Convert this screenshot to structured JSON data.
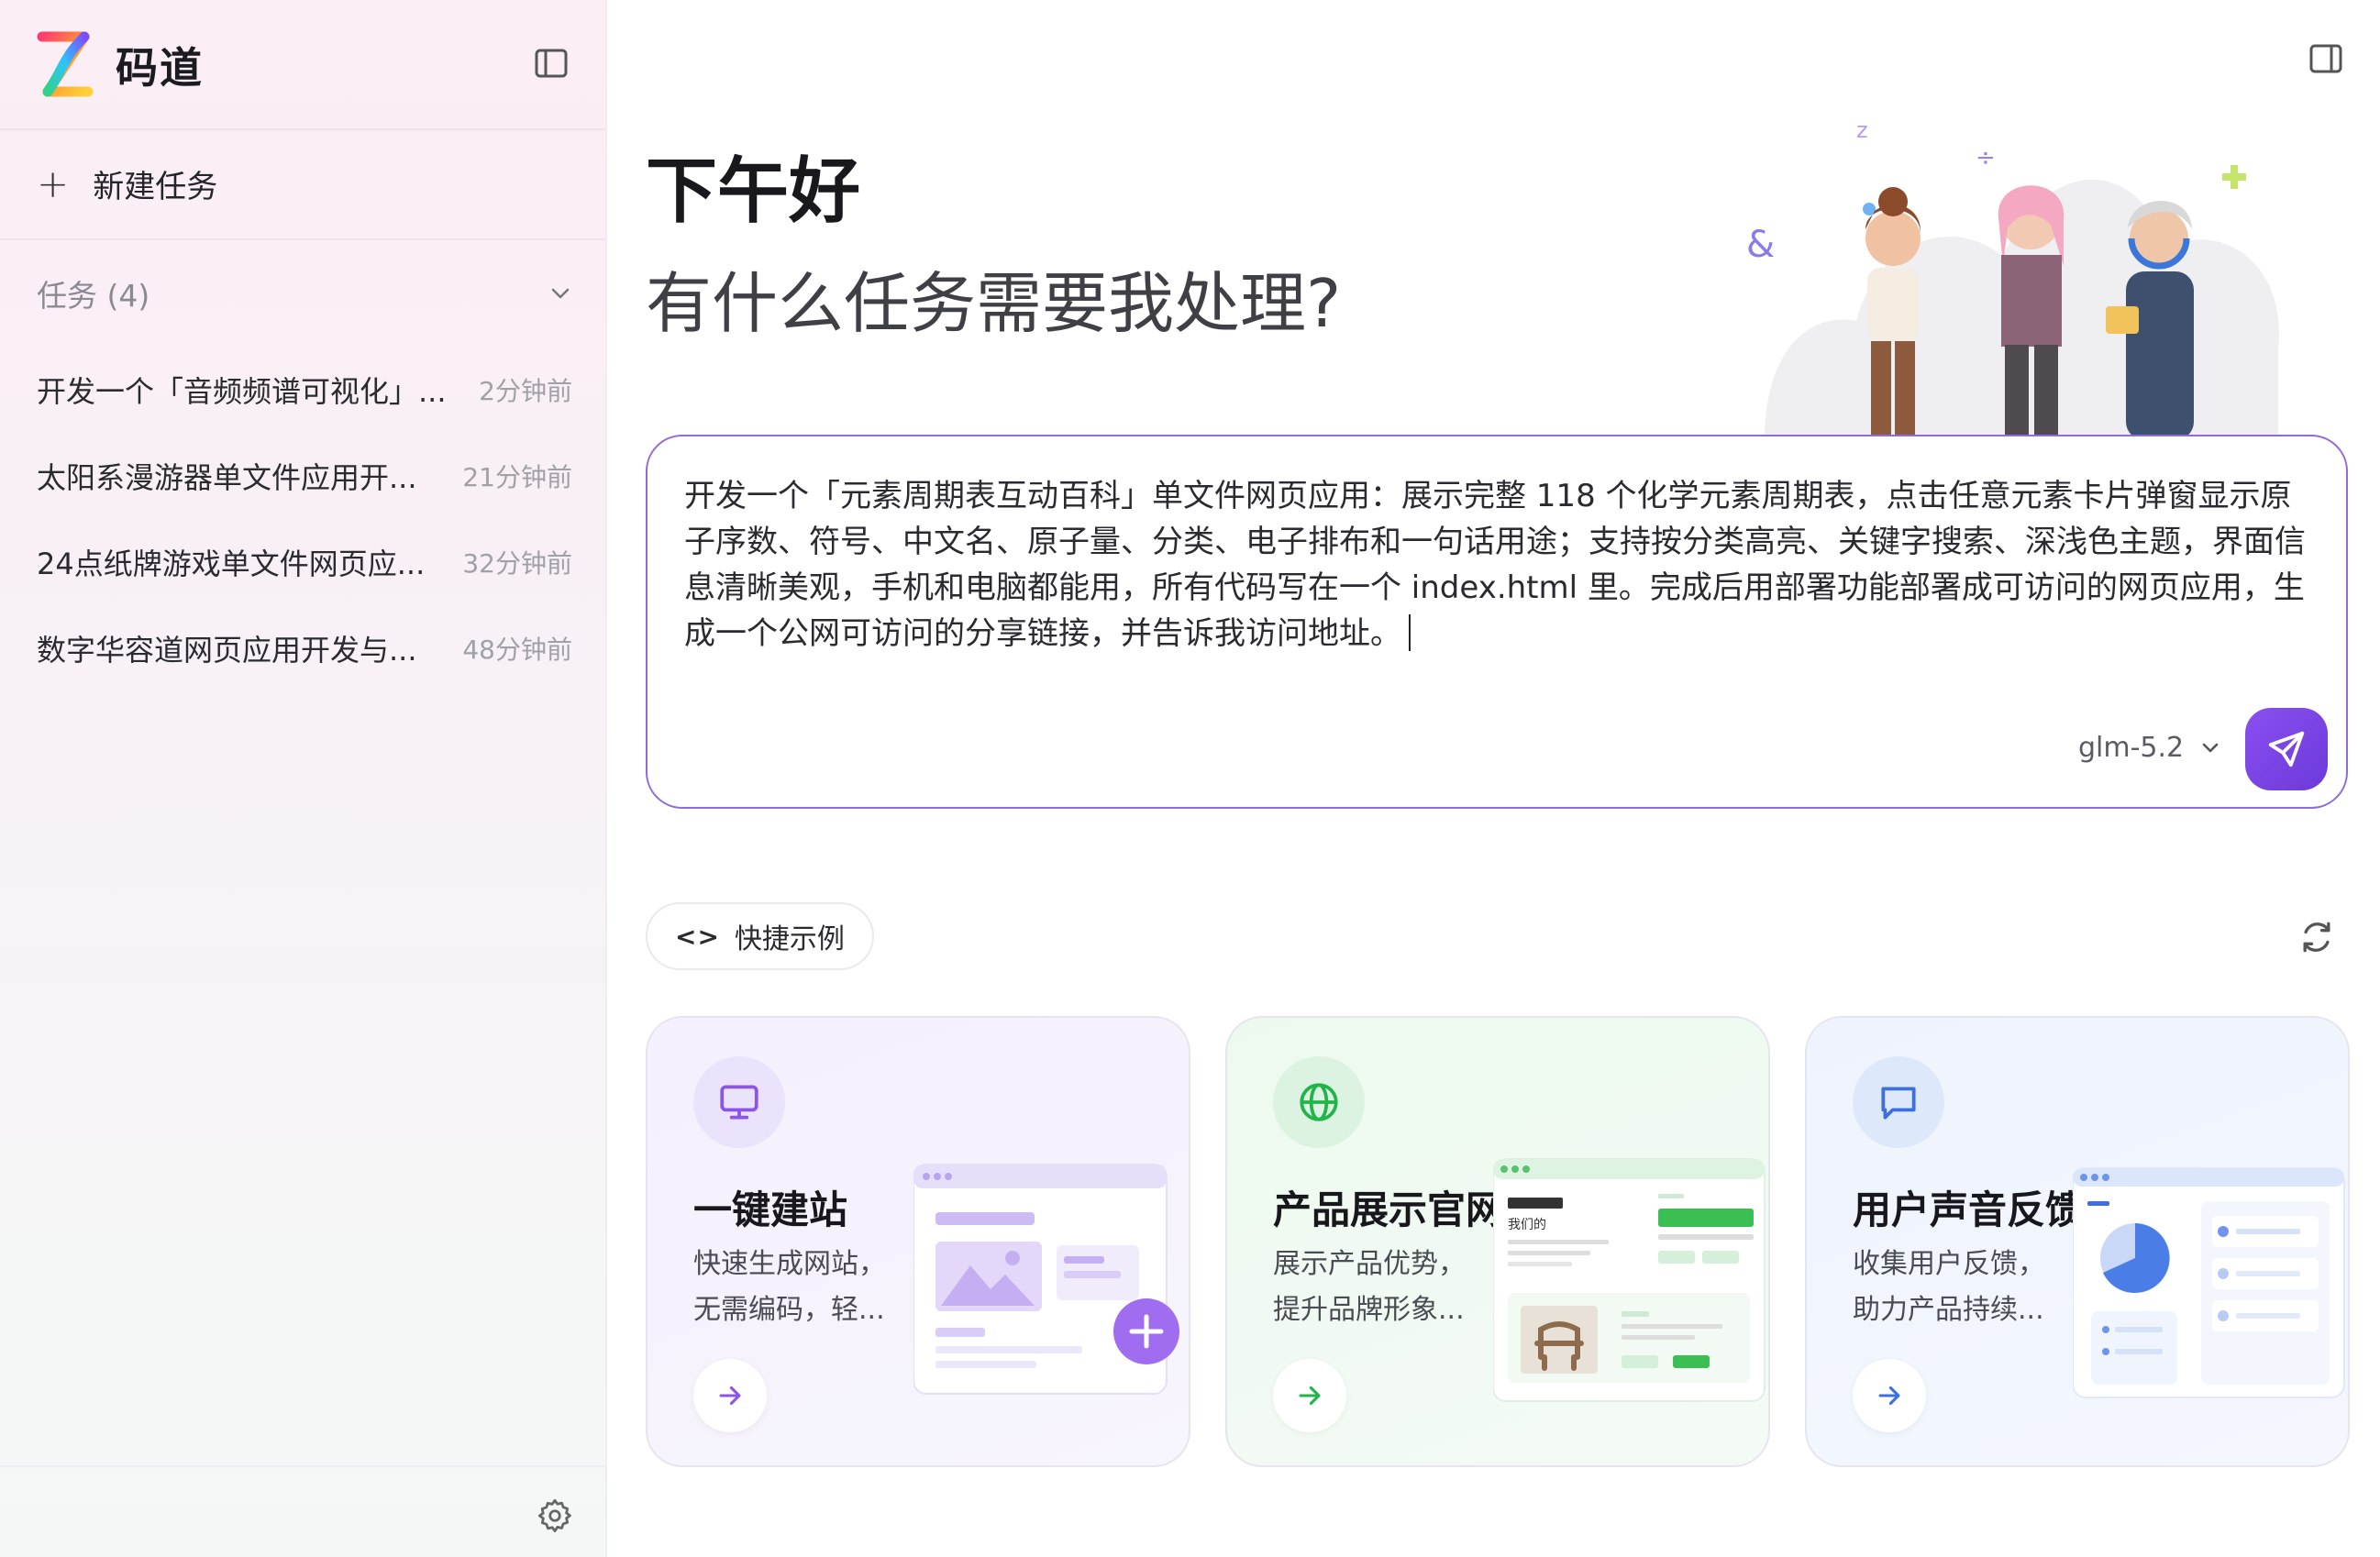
{
  "brand": {
    "name": "码道"
  },
  "sidebar": {
    "new_task_label": "新建任务",
    "tasks_header": "任务 (4)",
    "tasks": [
      {
        "title": "开发一个「音频频谱可视化」...",
        "time": "2分钟前"
      },
      {
        "title": "太阳系漫游器单文件应用开...",
        "time": "21分钟前"
      },
      {
        "title": "24点纸牌游戏单文件网页应...",
        "time": "32分钟前"
      },
      {
        "title": "数字华容道网页应用开发与...",
        "time": "48分钟前"
      }
    ]
  },
  "main": {
    "greeting": "下午好",
    "subgreeting": "有什么任务需要我处理?",
    "composer": {
      "text": "开发一个「元素周期表互动百科」单文件网页应用：展示完整 118 个化学元素周期表，点击任意元素卡片弹窗显示原子序数、符号、中文名、原子量、分类、电子排布和一句话用途；支持按分类高亮、关键字搜索、深浅色主题，界面信息清晰美观，手机和电脑都能用，所有代码写在一个 index.html 里。完成后用部署功能部署成可访问的网页应用，生成一个公网可访问的分享链接，并告诉我访问地址。",
      "model": "glm-5.2"
    },
    "quick_examples_label": "快捷示例",
    "cards": [
      {
        "title": "一键建站",
        "desc": "快速生成网站，无需编码，轻...",
        "icon": "monitor-icon"
      },
      {
        "title": "产品展示官网",
        "desc": "展示产品优势，提升品牌形象...",
        "icon": "globe-icon"
      },
      {
        "title": "用户声音反馈",
        "desc": "收集用户反馈，助力产品持续...",
        "icon": "message-icon"
      }
    ],
    "card2_art_text": "我们的"
  },
  "colors": {
    "accent": "#7b45e6",
    "green": "#22b44a",
    "blue": "#3d6fe0"
  }
}
